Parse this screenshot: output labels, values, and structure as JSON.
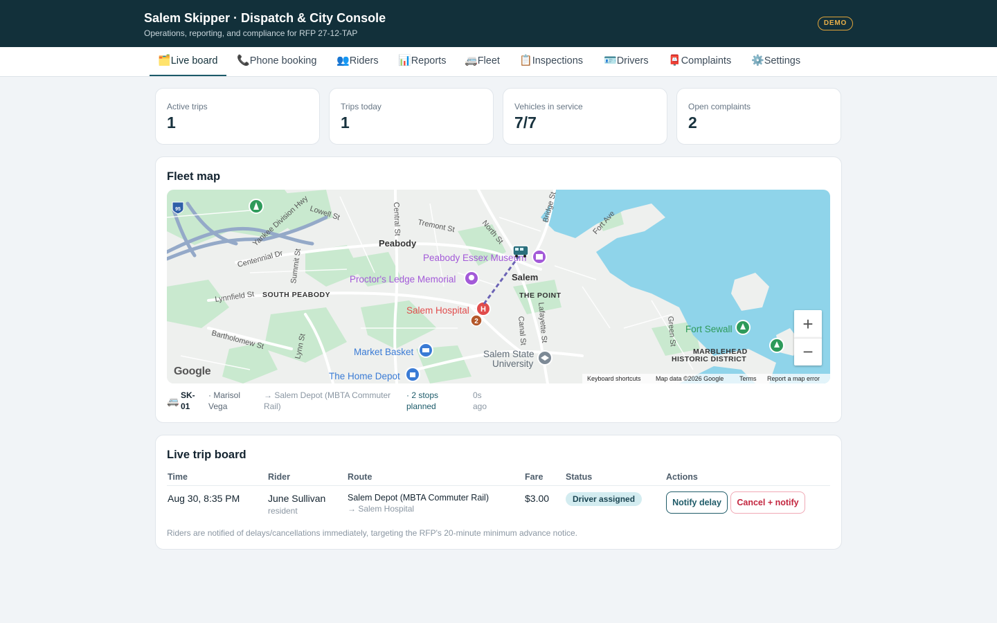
{
  "header": {
    "title": "Salem Skipper · Dispatch & City Console",
    "subtitle": "Operations, reporting, and compliance for RFP 27-12-TAP",
    "badge": "DEMO"
  },
  "tabs": [
    {
      "icon": "🗂️",
      "label": "Live board"
    },
    {
      "icon": "📞",
      "label": "Phone booking"
    },
    {
      "icon": "👥",
      "label": "Riders"
    },
    {
      "icon": "📊",
      "label": "Reports"
    },
    {
      "icon": "🚐",
      "label": "Fleet"
    },
    {
      "icon": "📋",
      "label": "Inspections"
    },
    {
      "icon": "🪪",
      "label": "Drivers"
    },
    {
      "icon": "📮",
      "label": "Complaints"
    },
    {
      "icon": "⚙️",
      "label": "Settings"
    }
  ],
  "stats": [
    {
      "label": "Active trips",
      "value": "1"
    },
    {
      "label": "Trips today",
      "value": "1"
    },
    {
      "label": "Vehicles in service",
      "value": "7/7"
    },
    {
      "label": "Open complaints",
      "value": "2"
    }
  ],
  "fleet_map": {
    "title": "Fleet map",
    "labels": {
      "peabody": "Peabody",
      "salem": "Salem",
      "south_peabody": "SOUTH PEABODY",
      "the_point": "THE POINT",
      "marblehead": "MARBLEHEAD",
      "historic": "HISTORIC DISTRICT",
      "pem": "Peabody Essex Museum",
      "proctor": "Proctor's Ledge Memorial",
      "hospital": "Salem Hospital",
      "market": "Market Basket",
      "depot": "The Home Depot",
      "ssu1": "Salem State",
      "ssu2": "University",
      "fort": "Fort Sewall",
      "lowell": "Lowell St",
      "central": "Central St",
      "tremont": "Tremont St",
      "north": "North St",
      "bridge": "Bridge St",
      "fortave": "Fort Ave",
      "yankee": "Yankee Division Hwy",
      "centennial": "Centennial Dr",
      "summit": "Summit St",
      "lynnfield": "Lynnfield St",
      "bartholomew": "Bartholomew St",
      "lynn": "Lynn St",
      "canal": "Canal St",
      "lafayette": "Lafayette St",
      "green": "Green St",
      "i95": "95",
      "stop_num": "2"
    },
    "attribution": {
      "logo": "Google",
      "shortcuts": "Keyboard shortcuts",
      "mapdata": "Map data ©2026 Google",
      "terms": "Terms",
      "report": "Report a map error"
    },
    "zoom_in": "+",
    "zoom_out": "−",
    "vehicle": {
      "icon": "🚐",
      "id": "SK-01",
      "driver": "· Marisol Vega",
      "destination": "→ Salem Depot (MBTA Commuter Rail)",
      "stops": "· 2 stops planned",
      "updated": "0s ago"
    }
  },
  "trip_board": {
    "title": "Live trip board",
    "columns": [
      "Time",
      "Rider",
      "Route",
      "Fare",
      "Status",
      "Actions"
    ],
    "rows": [
      {
        "time": "Aug 30, 8:35 PM",
        "rider": "June Sullivan",
        "rider_type": "resident",
        "route_from": "Salem Depot (MBTA Commuter Rail)",
        "route_to": "→ Salem Hospital",
        "fare": "$3.00",
        "status": "Driver assigned",
        "actions": [
          "Notify delay",
          "Cancel + notify"
        ]
      }
    ],
    "note": "Riders are notified of delays/cancellations immediately, targeting the RFP's 20-minute minimum advance notice."
  },
  "colors": {
    "header_bg": "#12303a",
    "accent": "#1b5a69",
    "danger": "#c3263f",
    "status_bg": "#d3ecf0",
    "water": "#8fd4ea",
    "park": "#c9e9cf"
  }
}
